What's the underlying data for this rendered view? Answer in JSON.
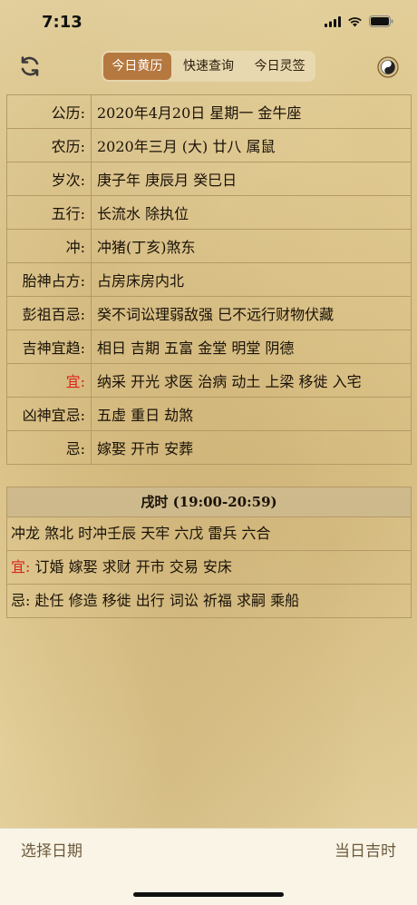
{
  "status": {
    "time": "7:13"
  },
  "tabs": [
    {
      "label": "今日黄历",
      "active": true
    },
    {
      "label": "快速查询",
      "active": false
    },
    {
      "label": "今日灵签",
      "active": false
    }
  ],
  "almanac": [
    {
      "label": "公历:",
      "value": "2020年4月20日 星期一 金牛座",
      "red": false
    },
    {
      "label": "农历:",
      "value": "2020年三月 (大) 廿八 属鼠",
      "red": false
    },
    {
      "label": "岁次:",
      "value": "庚子年 庚辰月 癸巳日",
      "red": false
    },
    {
      "label": "五行:",
      "value": "长流水 除执位",
      "red": false
    },
    {
      "label": "冲:",
      "value": "冲猪(丁亥)煞东",
      "red": false
    },
    {
      "label": "胎神占方:",
      "value": "占房床房内北",
      "red": false
    },
    {
      "label": "彭祖百忌:",
      "value": "癸不词讼理弱敌强 巳不远行财物伏藏",
      "red": false
    },
    {
      "label": "吉神宜趋:",
      "value": "相日 吉期 五富 金堂 明堂 阴德",
      "red": false
    },
    {
      "label": "宜:",
      "value": "纳采 开光 求医 治病 动土 上梁 移徙 入宅",
      "red": true
    },
    {
      "label": "凶神宜忌:",
      "value": "五虚 重日 劫煞",
      "red": false
    },
    {
      "label": "忌:",
      "value": "嫁娶 开市 安葬",
      "red": false
    }
  ],
  "hour": {
    "title": "戌时 (19:00-20:59)",
    "line": "冲龙 煞北 时冲壬辰 天牢 六戊 雷兵 六合",
    "yi_label": "宜:",
    "yi_value": "订婚 嫁娶 求财 开市 交易 安床",
    "ji_label": "忌:",
    "ji_value": "赴任 修造 移徙 出行 词讼 祈福 求嗣 乘船"
  },
  "bottom": {
    "left": "选择日期",
    "right": "当日吉时"
  },
  "colors": {
    "accent": "#b5783f",
    "red": "#d9251b",
    "border": "#b59a66"
  },
  "icons": {
    "refresh": "refresh-icon",
    "settings": "yin-yang-icon"
  }
}
